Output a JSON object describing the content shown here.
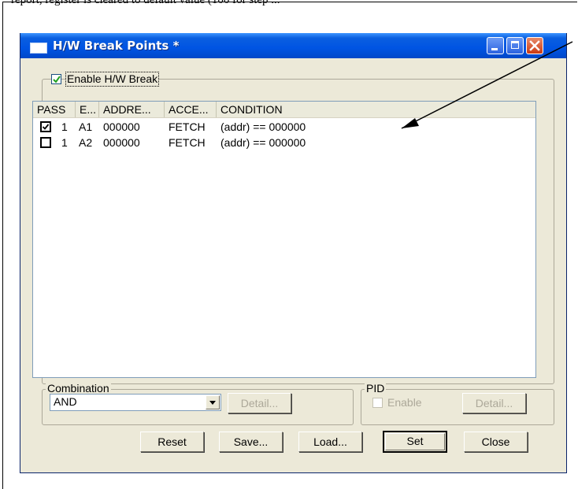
{
  "clip_text": "report, register is cleared to default value (100 for step ...",
  "window": {
    "title": "H/W Break Points *",
    "controls": {
      "minimize": "minimize-icon",
      "maximize": "maximize-icon",
      "close": "close-icon"
    }
  },
  "enable_hw_break": {
    "label": "Enable H/W Break",
    "checked": true
  },
  "table": {
    "columns": [
      "PASS",
      "E...",
      "ADDRE...",
      "ACCE...",
      "CONDITION"
    ],
    "rows": [
      {
        "pass": true,
        "count": "1",
        "e": "A1",
        "address": "000000",
        "access": "FETCH",
        "condition": "(addr) == 000000"
      },
      {
        "pass": false,
        "count": "1",
        "e": "A2",
        "address": "000000",
        "access": "FETCH",
        "condition": "(addr) == 000000"
      }
    ]
  },
  "combination": {
    "label": "Combination",
    "value": "AND",
    "detail_label": "Detail..."
  },
  "pid": {
    "label": "PID",
    "enable_label": "Enable",
    "enable_checked": false,
    "detail_label": "Detail..."
  },
  "buttons": {
    "reset": "Reset",
    "save": "Save...",
    "load": "Load...",
    "set": "Set",
    "close": "Close"
  },
  "colors": {
    "titlebar": "#0054e3",
    "dialog_bg": "#ece9d8",
    "close_button": "#cc3a12"
  }
}
